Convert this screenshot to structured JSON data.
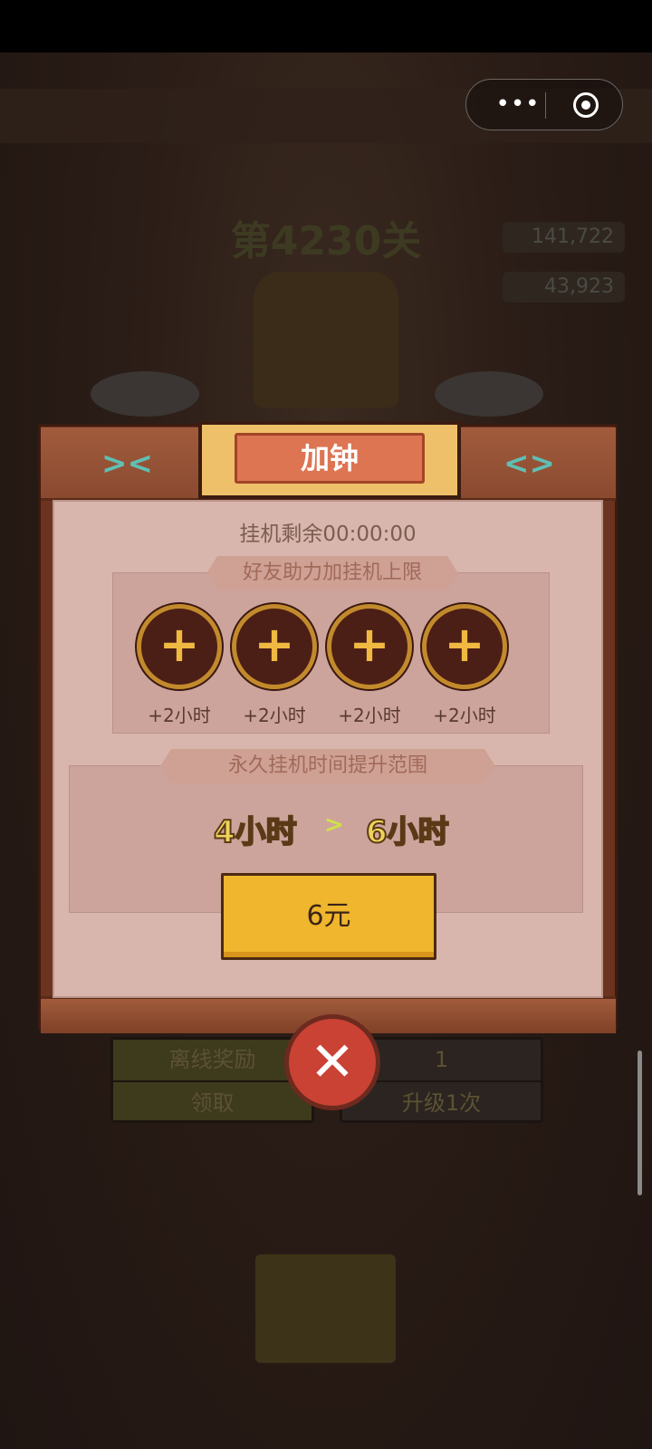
{
  "background": {
    "level": "第4230关",
    "stats": [
      "141,722",
      "43,923"
    ],
    "offline_reward_label": "离线奖励",
    "claim_label": "领取",
    "upgrade_count": "1",
    "upgrade_label": "升级1次"
  },
  "modal": {
    "title": "加钟",
    "remaining": "挂机剩余00:00:00",
    "friend_section_title": "好友助力加挂机上限",
    "friend_slots": [
      {
        "icon": "+",
        "label": "+2小时"
      },
      {
        "icon": "+",
        "label": "+2小时"
      },
      {
        "icon": "+",
        "label": "+2小时"
      },
      {
        "icon": "+",
        "label": "+2小时"
      }
    ],
    "permanent_section_title": "永久挂机时间提升范围",
    "from_hours": "4小时",
    "arrow": ">",
    "to_hours": "6小时",
    "price_label": "6元",
    "close_symbol": "✕"
  },
  "miniprogram_capsule": {
    "menu_icon": "more-dots-icon",
    "close_icon": "target-close-icon"
  },
  "colors": {
    "frame": "#6a3420",
    "panel": "#d9b6ad",
    "button": "#efb62e",
    "close": "#c94234"
  }
}
